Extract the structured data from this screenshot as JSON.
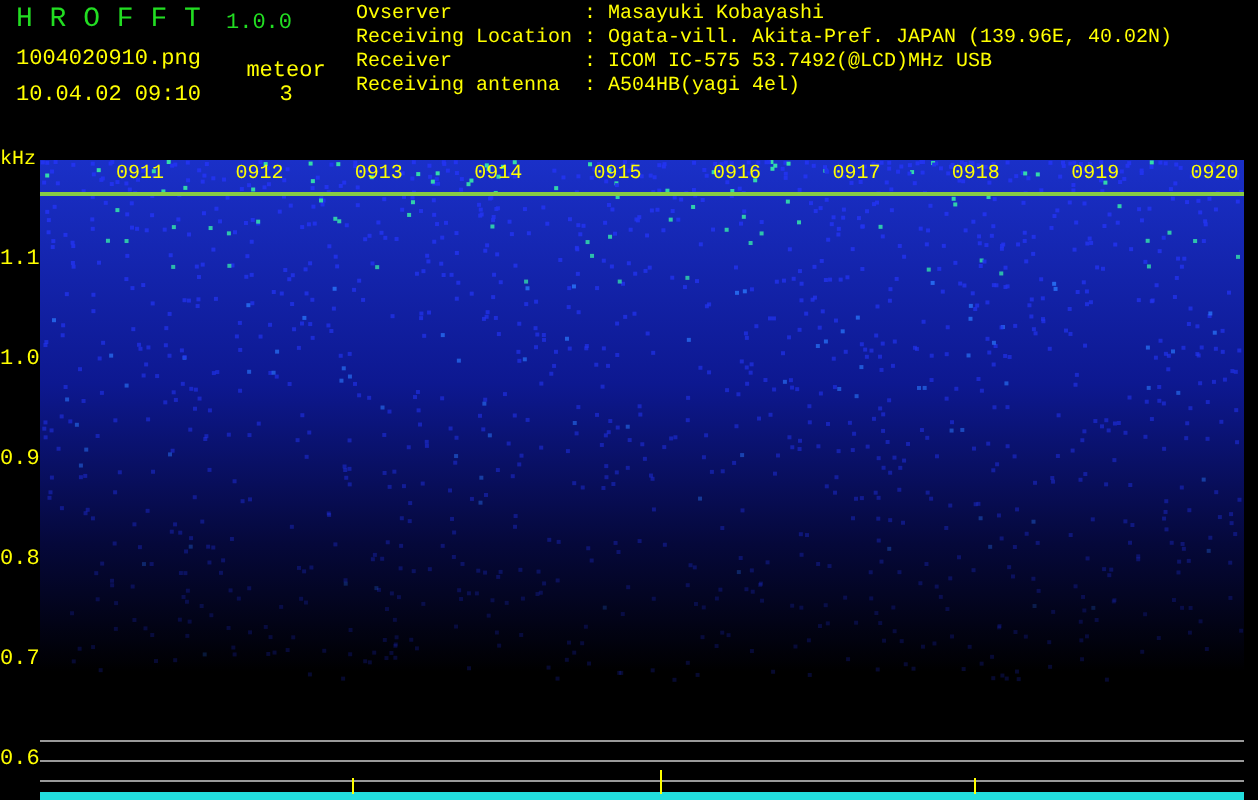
{
  "app": {
    "title": "H R O F F T",
    "version": "1.0.0"
  },
  "file": "1004020910.png",
  "datetime": "10.04.02 09:10",
  "meteor": {
    "label": "meteor",
    "count": "3"
  },
  "info": [
    {
      "label": "Ovserver",
      "value": ": Masayuki Kobayashi"
    },
    {
      "label": "Receiving Location",
      "value": ": Ogata-vill. Akita-Pref. JAPAN (139.96E, 40.02N)"
    },
    {
      "label": "Receiver",
      "value": ": ICOM IC-575 53.7492(@LCD)MHz USB"
    },
    {
      "label": "Receiving antenna",
      "value": ": A504HB(yagi 4el)"
    }
  ],
  "y_unit": "kHz",
  "y_labels": [
    "1.1",
    "1.0",
    "0.9",
    "0.8",
    "0.7",
    "0.6"
  ],
  "x_labels": [
    "0911",
    "0912",
    "0913",
    "0914",
    "0915",
    "0916",
    "0917",
    "0918",
    "0919",
    "0920"
  ]
}
